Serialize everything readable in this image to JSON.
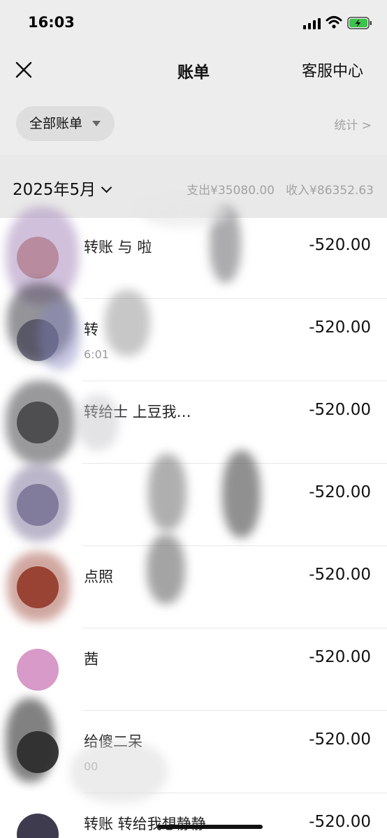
{
  "status_bar": {
    "time": "16:03"
  },
  "nav": {
    "title": "账单",
    "right": "客服中心"
  },
  "filter": {
    "label": "全部账单",
    "stats": "统计 >"
  },
  "month_bar": {
    "month": "2025年5月",
    "expense": "支出¥35080.00",
    "income": "收入¥86352.63"
  },
  "transactions": [
    {
      "title": "转账   与       啦",
      "subtitle": "",
      "amount": "-520.00",
      "avatar_color": "#c98a78"
    },
    {
      "title": "转",
      "subtitle": "                6:01",
      "amount": "-520.00",
      "avatar_color": "#7a7a8f"
    },
    {
      "title": "        转给士   上豆我…",
      "subtitle": "",
      "amount": "-520.00",
      "avatar_color": "#5a5a5a"
    },
    {
      "title": "",
      "subtitle": "",
      "amount": "-520.00",
      "avatar_color": "#8d8aa2"
    },
    {
      "title": "               点照",
      "subtitle": "",
      "amount": "-520.00",
      "avatar_color": "#9a4a3a"
    },
    {
      "title": "               茜",
      "subtitle": "",
      "amount": "-520.00",
      "avatar_color": "#d89ac8"
    },
    {
      "title": "          给傻二呆",
      "subtitle": "                00",
      "amount": "-520.00",
      "avatar_color": "#3a3a3a"
    },
    {
      "title": "转账  转给我想静静",
      "subtitle": "",
      "amount": "-520.00",
      "avatar_color": "#3e3b4e"
    }
  ]
}
